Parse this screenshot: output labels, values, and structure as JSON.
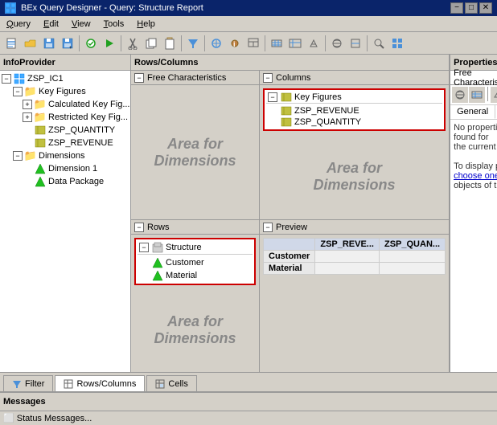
{
  "titleBar": {
    "icon": "bex-icon",
    "title": "BEx Query Designer - Query: Structure Report",
    "minimize": "−",
    "maximize": "□",
    "close": "✕"
  },
  "menuBar": {
    "items": [
      "Query",
      "Edit",
      "View",
      "Tools",
      "Help"
    ]
  },
  "infoProvider": {
    "header": "InfoProvider",
    "rootNode": "ZSP_IC1",
    "nodes": [
      {
        "id": "key-figures",
        "label": "Key Figures",
        "indent": 0,
        "expanded": true,
        "type": "folder"
      },
      {
        "id": "calc-kf",
        "label": "Calculated Key Fig...",
        "indent": 1,
        "type": "folder"
      },
      {
        "id": "restricted-kf",
        "label": "Restricted Key Fig...",
        "indent": 1,
        "type": "folder"
      },
      {
        "id": "zsp-quantity",
        "label": "ZSP_QUANTITY",
        "indent": 1,
        "type": "kf"
      },
      {
        "id": "zsp-revenue",
        "label": "ZSP_REVENUE",
        "indent": 1,
        "type": "kf"
      },
      {
        "id": "dimensions",
        "label": "Dimensions",
        "indent": 0,
        "expanded": true,
        "type": "folder"
      },
      {
        "id": "dim1",
        "label": "Dimension 1",
        "indent": 1,
        "type": "dim"
      },
      {
        "id": "data-pkg",
        "label": "Data Package",
        "indent": 1,
        "type": "dim"
      }
    ]
  },
  "rowsCols": {
    "header": "Rows/Columns",
    "freeChars": {
      "label": "Free Characteristics",
      "areaText": "Area for\nDimensions"
    },
    "columns": {
      "label": "Columns",
      "areaText": "Area for\nDimensions",
      "keyFiguresNode": "Key Figures",
      "items": [
        "ZSP_REVENUE",
        "ZSP_QUANTITY"
      ]
    },
    "rows": {
      "label": "Rows",
      "areaText": "Area for\nDimensions",
      "structureNode": "Structure",
      "items": [
        "Customer",
        "Material"
      ]
    },
    "preview": {
      "label": "Preview",
      "colHeaders": [
        "ZSP_REVE...",
        "ZSP_QUAN..."
      ],
      "rowHeaders": [
        "Customer",
        "Material"
      ]
    }
  },
  "properties": {
    "header": "Properties",
    "subHeader": "Free Characteris...",
    "tabs": [
      "General"
    ],
    "content": "No properties are\nfound for\nthe current sele...\n\nTo display prop...\nchoose one or...\nobjects of the s...",
    "chooseOneText": "choose one or..."
  },
  "bottomTabs": [
    {
      "id": "filter",
      "label": "Filter",
      "icon": "filter"
    },
    {
      "id": "rows-cols",
      "label": "Rows/Columns",
      "icon": "rows-cols",
      "active": true
    },
    {
      "id": "cells",
      "label": "Cells",
      "icon": "cells"
    }
  ],
  "messagesBar": {
    "label": "Messages"
  },
  "statusBar": {
    "text": "⬜ Status Messages..."
  }
}
